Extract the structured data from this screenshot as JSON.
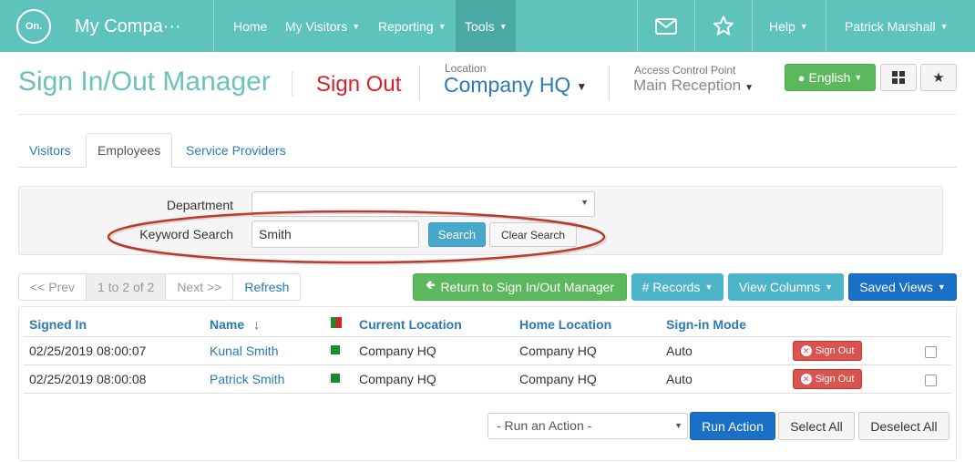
{
  "nav": {
    "logo": "On.",
    "company": "My Compa···",
    "items": [
      {
        "label": "Home"
      },
      {
        "label": "My Visitors"
      },
      {
        "label": "Reporting"
      },
      {
        "label": "Tools"
      },
      {
        "label": "Help"
      },
      {
        "label": "Patrick Marshall"
      }
    ],
    "icons": [
      "mail-icon",
      "star-icon"
    ],
    "active_item": "Tools",
    "color": "#5ec3bd"
  },
  "header": {
    "title": "Sign In/Out Manager",
    "mode": "Sign Out",
    "location_label": "Location",
    "location_value": "Company HQ",
    "acp_label": "Access Control Point",
    "acp_value": "Main Reception",
    "language": "English"
  },
  "tabs": [
    {
      "label": "Visitors"
    },
    {
      "label": "Employees"
    },
    {
      "label": "Service Providers"
    }
  ],
  "active_tab": "Employees",
  "search": {
    "department_label": "Department",
    "department_value": "",
    "keyword_label": "Keyword Search",
    "keyword_value": "Smith",
    "search_label": "Search",
    "clear_label": "Clear Search"
  },
  "pager": {
    "prev": "<< Prev",
    "range": "1 to 2 of 2",
    "next": "Next >>",
    "refresh": "Refresh"
  },
  "actions": {
    "return": "Return to Sign In/Out Manager",
    "records": "# Records",
    "view_columns": "View Columns",
    "saved_views": "Saved Views"
  },
  "table": {
    "columns": [
      "Signed In",
      "Name",
      "Current Location",
      "Home Location",
      "Sign-in Mode"
    ],
    "sort_indicator": "↓",
    "rows": [
      {
        "signed_in": "02/25/2019 08:00:07",
        "name": "Kunal Smith",
        "current_location": "Company HQ",
        "home_location": "Company HQ",
        "mode": "Auto",
        "action": "Sign Out"
      },
      {
        "signed_in": "02/25/2019 08:00:08",
        "name": "Patrick Smith",
        "current_location": "Company HQ",
        "home_location": "Company HQ",
        "mode": "Auto",
        "action": "Sign Out"
      }
    ]
  },
  "footer": {
    "action_placeholder": "- Run an Action -",
    "run_action": "Run Action",
    "select_all": "Select All",
    "deselect_all": "Deselect All"
  }
}
